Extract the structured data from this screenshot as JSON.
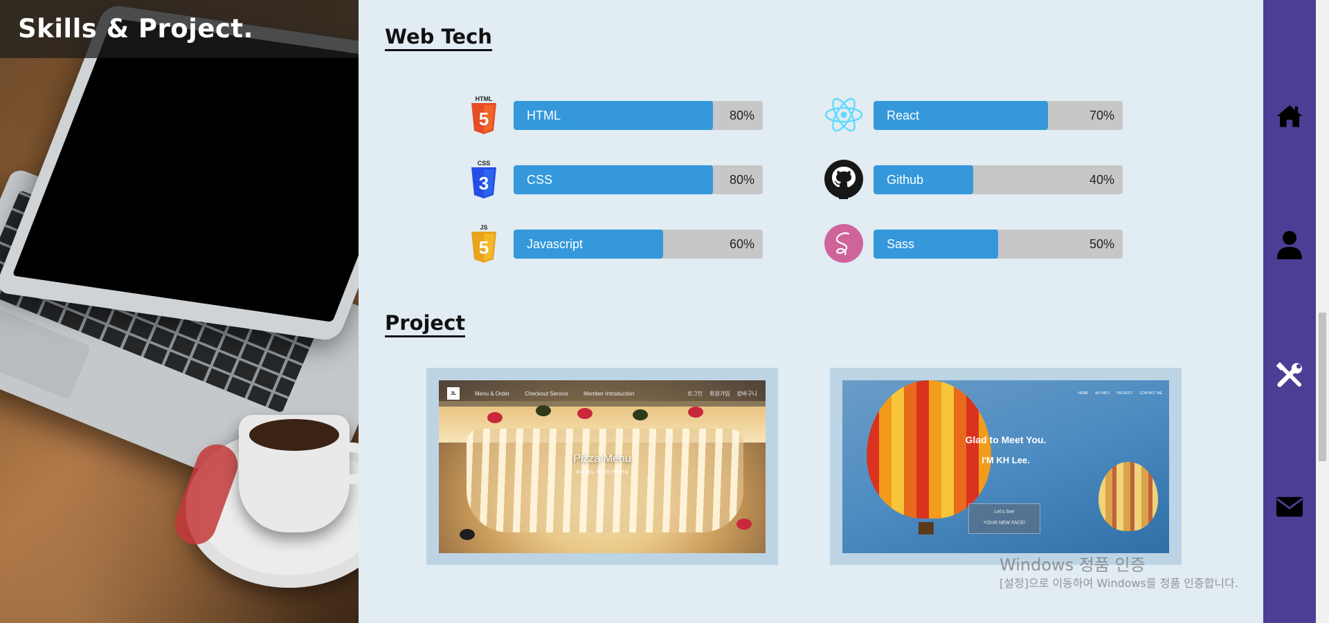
{
  "page": {
    "title": "Skills & Project."
  },
  "web_tech": {
    "heading": "Web Tech",
    "skills": [
      {
        "name": "HTML",
        "percent": 80,
        "percent_label": "80%",
        "icon": "html5-icon",
        "color": "#e44d26",
        "badge": "HTML"
      },
      {
        "name": "CSS",
        "percent": 80,
        "percent_label": "80%",
        "icon": "css3-icon",
        "color": "#264de4",
        "badge": "CSS"
      },
      {
        "name": "Javascript",
        "percent": 60,
        "percent_label": "60%",
        "icon": "js-icon",
        "color": "#f0a51a",
        "badge": "JS"
      },
      {
        "name": "React",
        "percent": 70,
        "percent_label": "70%",
        "icon": "react-icon",
        "color": "#61dafb"
      },
      {
        "name": "Github",
        "percent": 40,
        "percent_label": "40%",
        "icon": "github-icon",
        "color": "#181717"
      },
      {
        "name": "Sass",
        "percent": 50,
        "percent_label": "50%",
        "icon": "sass-icon",
        "color": "#cf649a"
      }
    ]
  },
  "project": {
    "heading": "Project",
    "items": [
      {
        "nav_logo": "JL",
        "nav_links": [
          "Menu & Order",
          "Checkout Service",
          "Member Introduction"
        ],
        "nav_right": [
          "로그인",
          "회원가입",
          "장바구니"
        ],
        "heading": "Pizza Menu",
        "sub": "피자 메뉴 페이지 (한) 가요"
      },
      {
        "nav_links": [
          "HOME",
          "MY INFO",
          "PROJECT",
          "CONTACT ME"
        ],
        "line1": "Glad to Meet You.",
        "line2": "I'M KH Lee.",
        "btn_line1": "Let's See",
        "btn_line2": "YOUR NEW FACE!"
      }
    ]
  },
  "watermark": {
    "line1": "Windows 정품 인증",
    "line2": "[설정]으로 이동하여 Windows를 정품 인증합니다."
  },
  "right_nav": [
    {
      "icon": "home-icon"
    },
    {
      "icon": "user-icon"
    },
    {
      "icon": "tools-icon"
    },
    {
      "icon": "envelope-icon"
    }
  ],
  "colors": {
    "accent": "#3498db",
    "nav_bg": "#4a3f94",
    "track": "#c7c7c7",
    "bg": "#e1ecf3"
  }
}
